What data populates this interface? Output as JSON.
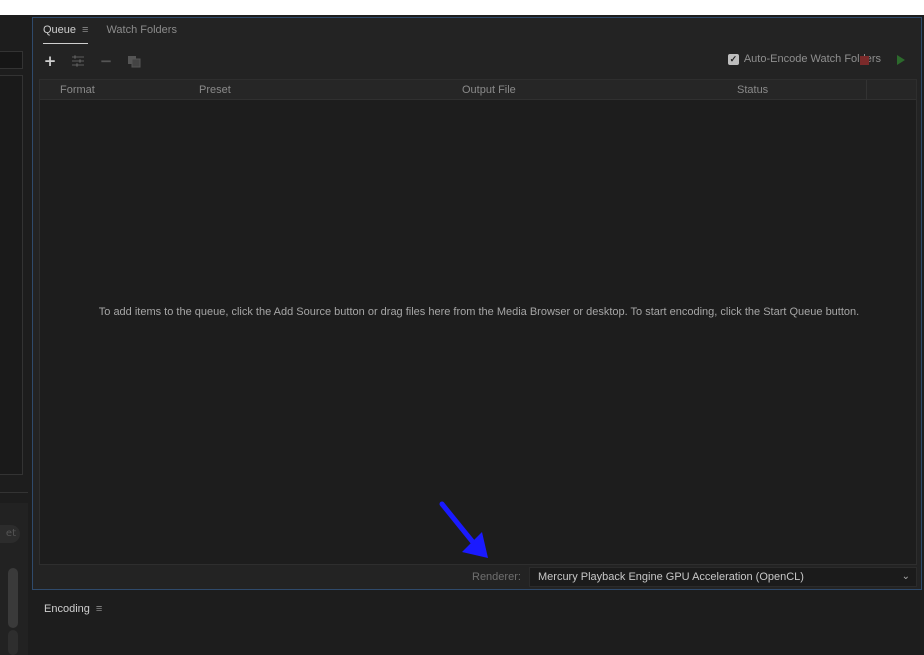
{
  "queue_panel": {
    "tabs": [
      {
        "label": "Queue",
        "menu": "≡"
      },
      {
        "label": "Watch Folders"
      }
    ],
    "toolbar": {
      "add_icon": "plus-icon",
      "settings_icon": "sliders-icon",
      "remove_icon": "minus-icon",
      "duplicate_icon": "duplicate-icon"
    },
    "auto_encode": {
      "label": "Auto-Encode Watch Folders",
      "checked": true
    },
    "columns": [
      "Format",
      "Preset",
      "Output File",
      "Status"
    ],
    "empty_message": "To add items to the queue, click the Add Source button or drag files here from the Media Browser or desktop.  To start encoding, click the Start Queue button.",
    "renderer": {
      "label": "Renderer:",
      "value": "Mercury Playback Engine GPU Acceleration (OpenCL)"
    }
  },
  "encoding_panel": {
    "title": "Encoding",
    "menu": "≡"
  },
  "left_panel": {
    "partial_button": "et"
  },
  "colors": {
    "accent_border": "#2f4a6b",
    "stop": "#7a2a2a",
    "play": "#2c6a2c",
    "annotation_arrow": "#1a1aff"
  }
}
